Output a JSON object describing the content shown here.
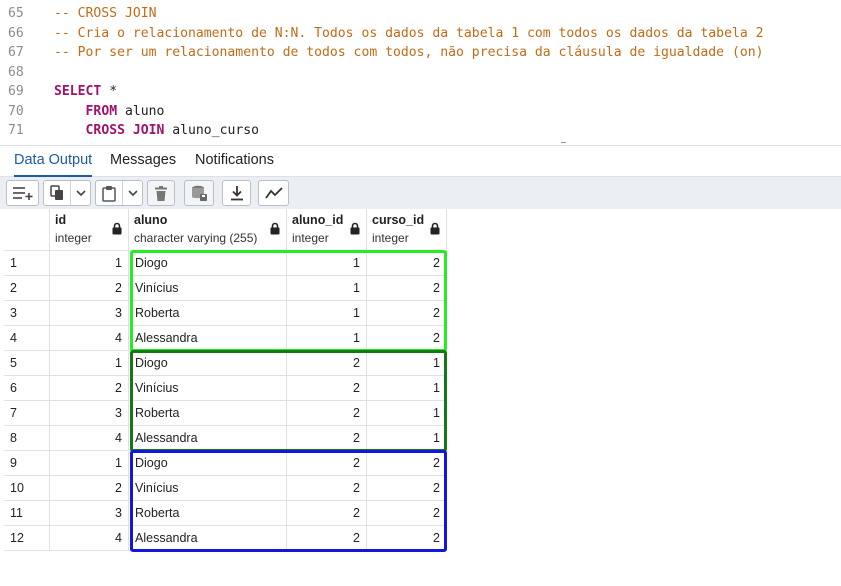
{
  "editor": {
    "lines": [
      {
        "num": "65",
        "parts": [
          {
            "t": "-- CROSS JOIN",
            "c": "comment"
          }
        ]
      },
      {
        "num": "66",
        "parts": [
          {
            "t": "-- Cria o relacionamento de N:N. Todos os dados da tabela 1 com todos os dados da tabela 2",
            "c": "comment"
          }
        ]
      },
      {
        "num": "67",
        "parts": [
          {
            "t": "-- Por ser um relacionamento de todos com todos, não precisa da cláusula de igualdade (on)",
            "c": "comment"
          }
        ]
      },
      {
        "num": "68",
        "parts": []
      },
      {
        "num": "69",
        "parts": [
          {
            "t": "SELECT",
            "c": "kw"
          },
          {
            "t": " *",
            "c": "plain"
          }
        ]
      },
      {
        "num": "70",
        "parts": [
          {
            "t": "    ",
            "c": "plain"
          },
          {
            "t": "FROM",
            "c": "kw"
          },
          {
            "t": " aluno",
            "c": "plain"
          }
        ]
      },
      {
        "num": "71",
        "parts": [
          {
            "t": "    ",
            "c": "plain"
          },
          {
            "t": "CROSS JOIN",
            "c": "kw"
          },
          {
            "t": " aluno_curso",
            "c": "plain"
          }
        ]
      }
    ]
  },
  "tabs": {
    "data_output": "Data Output",
    "messages": "Messages",
    "notifications": "Notifications",
    "active": "data_output"
  },
  "toolbar": {
    "buttons": [
      "add-row-icon",
      "copy-icon",
      "copy-dropdown-icon",
      "paste-icon",
      "paste-dropdown-icon",
      "delete-icon",
      "save-data-icon",
      "download-icon",
      "graph-icon"
    ]
  },
  "grid": {
    "columns": [
      {
        "name": "id",
        "type": "integer"
      },
      {
        "name": "aluno",
        "type": "character varying (255)"
      },
      {
        "name": "aluno_id",
        "type": "integer"
      },
      {
        "name": "curso_id",
        "type": "integer"
      }
    ],
    "rows": [
      [
        "1",
        "1",
        "Diogo",
        "1",
        "2"
      ],
      [
        "2",
        "2",
        "Vinícius",
        "1",
        "2"
      ],
      [
        "3",
        "3",
        "Roberta",
        "1",
        "2"
      ],
      [
        "4",
        "4",
        "Alessandra",
        "1",
        "2"
      ],
      [
        "5",
        "1",
        "Diogo",
        "2",
        "1"
      ],
      [
        "6",
        "2",
        "Vinícius",
        "2",
        "1"
      ],
      [
        "7",
        "3",
        "Roberta",
        "2",
        "1"
      ],
      [
        "8",
        "4",
        "Alessandra",
        "2",
        "1"
      ],
      [
        "9",
        "1",
        "Diogo",
        "2",
        "2"
      ],
      [
        "10",
        "2",
        "Vinícius",
        "2",
        "2"
      ],
      [
        "11",
        "3",
        "Roberta",
        "2",
        "2"
      ],
      [
        "12",
        "4",
        "Alessandra",
        "2",
        "2"
      ]
    ]
  },
  "highlights": [
    {
      "rows": [
        0,
        3
      ],
      "color": "#22ee22"
    },
    {
      "rows": [
        4,
        7
      ],
      "color": "#137a13"
    },
    {
      "rows": [
        8,
        11
      ],
      "color": "#1515e0"
    }
  ],
  "colors": {
    "accent": "#1e5aa8",
    "comment": "#c26b17",
    "keyword": "#a1116d"
  }
}
